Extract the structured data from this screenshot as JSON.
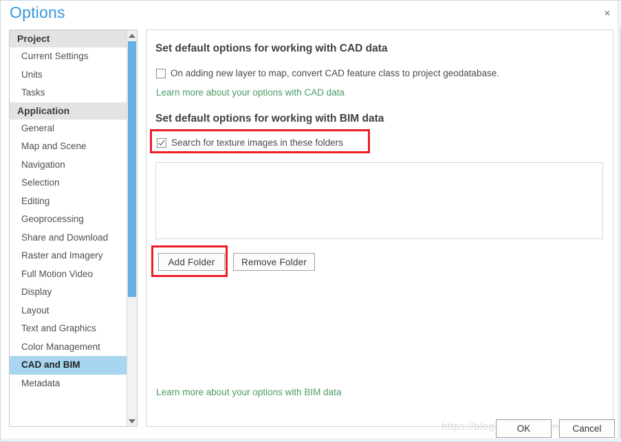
{
  "window": {
    "title": "Options",
    "close_label": "×"
  },
  "sidebar": {
    "groups": [
      {
        "header": "Project",
        "items": [
          {
            "label": "Current Settings",
            "selected": false
          },
          {
            "label": "Units",
            "selected": false
          },
          {
            "label": "Tasks",
            "selected": false
          }
        ]
      },
      {
        "header": "Application",
        "items": [
          {
            "label": "General",
            "selected": false
          },
          {
            "label": "Map and Scene",
            "selected": false
          },
          {
            "label": "Navigation",
            "selected": false
          },
          {
            "label": "Selection",
            "selected": false
          },
          {
            "label": "Editing",
            "selected": false
          },
          {
            "label": "Geoprocessing",
            "selected": false
          },
          {
            "label": "Share and Download",
            "selected": false
          },
          {
            "label": "Raster and Imagery",
            "selected": false
          },
          {
            "label": "Full Motion Video",
            "selected": false
          },
          {
            "label": "Display",
            "selected": false
          },
          {
            "label": "Layout",
            "selected": false
          },
          {
            "label": "Text and Graphics",
            "selected": false
          },
          {
            "label": "Color Management",
            "selected": false
          },
          {
            "label": "CAD and BIM",
            "selected": true
          },
          {
            "label": "Metadata",
            "selected": false
          }
        ]
      }
    ],
    "scrollbar": {
      "up_arrow": "scroll-up-arrow",
      "down_arrow": "scroll-down-arrow"
    }
  },
  "content": {
    "cad_section": {
      "heading": "Set default options for working with CAD data",
      "checkbox_label": "On adding new layer to map, convert CAD feature class to project geodatabase.",
      "checkbox_checked": false,
      "learn_link": "Learn more about your options with CAD data"
    },
    "bim_section": {
      "heading": "Set default options for working with BIM data",
      "checkbox_label": "Search for texture images in these folders",
      "checkbox_checked": true,
      "folder_list_items": [],
      "add_folder_label": "Add Folder",
      "remove_folder_label": "Remove Folder",
      "learn_link": "Learn more about your options with BIM data"
    }
  },
  "footer": {
    "ok_label": "OK",
    "cancel_label": "Cancel"
  },
  "watermark": {
    "text": "https://blog.csdn.net/sunfong00"
  },
  "colors": {
    "title_blue": "#3399dd",
    "selection_blue": "#a8d6f0",
    "scrollbar_blue": "#64b0e0",
    "link_green": "#4a9a62",
    "annotation_red": "#ec1c24",
    "group_header_gray": "#e3e3e3"
  }
}
